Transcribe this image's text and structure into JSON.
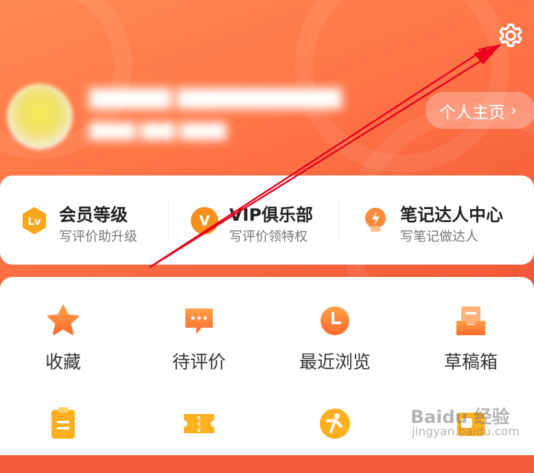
{
  "profile": {
    "homepage_label": "个人主页",
    "homepage_chevron": "›"
  },
  "features": [
    {
      "icon": "level-badge-icon",
      "title": "会员等级",
      "subtitle": "写评价助升级",
      "icon_text": "Lv"
    },
    {
      "icon": "vip-badge-icon",
      "title": "VIP俱乐部",
      "subtitle": "写评价领特权",
      "icon_text": "V"
    },
    {
      "icon": "lightbulb-icon",
      "title": "笔记达人中心",
      "subtitle": "写笔记做达人"
    }
  ],
  "grid": [
    {
      "icon": "star-icon",
      "label": "收藏"
    },
    {
      "icon": "comment-icon",
      "label": "待评价"
    },
    {
      "icon": "clock-icon",
      "label": "最近浏览"
    },
    {
      "icon": "drafts-inbox-icon",
      "label": "草稿箱"
    },
    {
      "icon": "clipboard-icon"
    },
    {
      "icon": "ticket-icon"
    },
    {
      "icon": "person-icon"
    },
    {
      "icon": "coupon-icon"
    }
  ],
  "watermark": {
    "brand": "Baidu 经验",
    "url": "jingyan.baidu.com"
  },
  "colors": {
    "accent": "#ff7446",
    "annotation_arrow": "#e8001c",
    "icon_orange": "#ff8a2a"
  }
}
